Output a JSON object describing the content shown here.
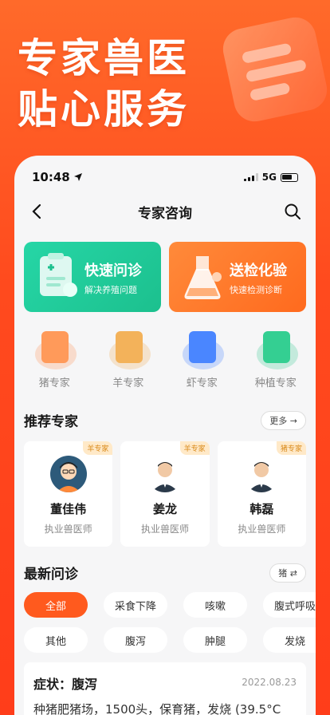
{
  "hero": {
    "line1": "专家兽医",
    "line2": "贴心服务"
  },
  "status_bar": {
    "time": "10:48",
    "network": "5G"
  },
  "nav": {
    "title": "专家咨询"
  },
  "services": [
    {
      "title": "快速问诊",
      "subtitle": "解决养殖问题"
    },
    {
      "title": "送检化验",
      "subtitle": "快速检测诊断"
    }
  ],
  "categories": [
    {
      "label": "猪专家",
      "icon": "pig-icon",
      "color": "#ff8a4a"
    },
    {
      "label": "羊专家",
      "icon": "sheep-icon",
      "color": "#f0a64a"
    },
    {
      "label": "虾专家",
      "icon": "shrimp-icon",
      "color": "#3a7bff"
    },
    {
      "label": "种植专家",
      "icon": "plant-icon",
      "color": "#2cc88a"
    }
  ],
  "recommend": {
    "heading": "推荐专家",
    "more_label": "更多 →"
  },
  "experts": [
    {
      "tag": "羊专家",
      "name": "董佳伟",
      "role": "执业兽医师"
    },
    {
      "tag": "羊专家",
      "name": "姜龙",
      "role": "执业兽医师"
    },
    {
      "tag": "猪专家",
      "name": "韩磊",
      "role": "执业兽医师"
    }
  ],
  "latest": {
    "heading": "最新问诊",
    "filter_label": "猪 ⇄"
  },
  "chips": {
    "row1": [
      "全部",
      "采食下降",
      "咳嗽",
      "腹式呼吸"
    ],
    "row2": [
      "其他",
      "腹泻",
      "肿腿",
      "发烧"
    ]
  },
  "case": {
    "symptom": "症状：腹泻",
    "date": "2022.08.23",
    "desc": "种猪肥猪场，1500头，保育猪，发烧 (39.5°C"
  },
  "colors": {
    "accent": "#ff5a1e",
    "green": "#1cc08e"
  }
}
